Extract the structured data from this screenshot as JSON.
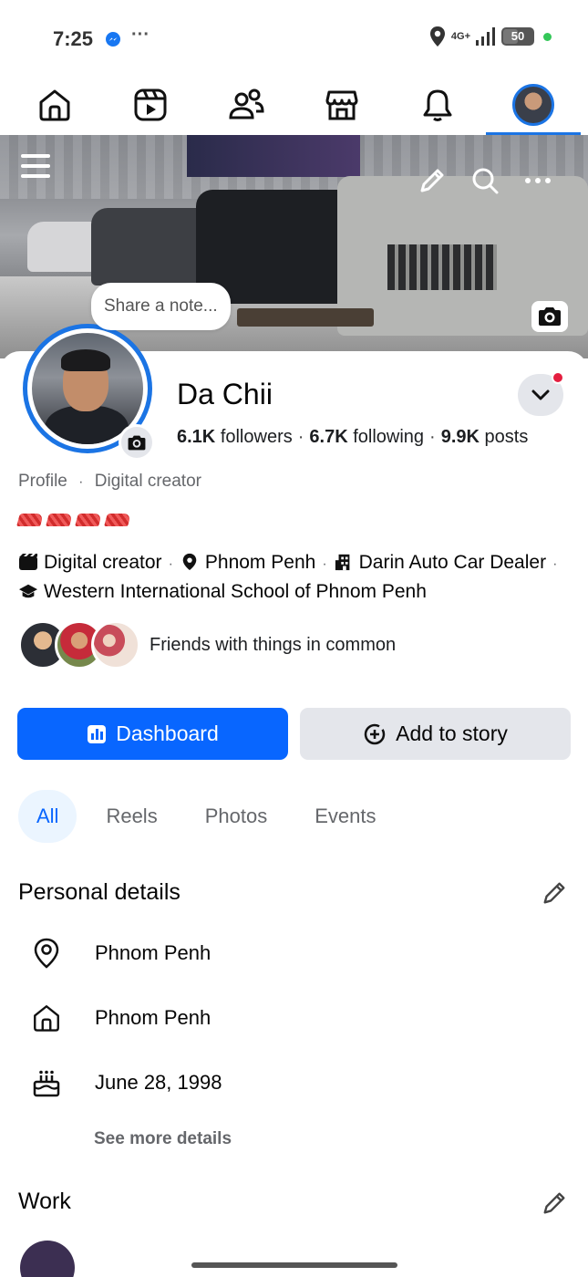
{
  "status_bar": {
    "time": "7:25",
    "more": "···",
    "network": "4G+",
    "battery": "50",
    "battery_level_percent": 50
  },
  "nav": {
    "items": [
      "home-icon",
      "reels-icon",
      "friends-icon",
      "marketplace-icon",
      "notifications-icon",
      "profile-avatar"
    ],
    "active_index": 5
  },
  "cover": {
    "note_prompt": "Share a note..."
  },
  "profile": {
    "name": "Da Chii",
    "followers_count": "6.1K",
    "followers_label": "followers",
    "following_count": "6.7K",
    "following_label": "following",
    "posts_count": "9.9K",
    "posts_label": "posts",
    "type": "Profile",
    "category": "Digital creator"
  },
  "intro": {
    "creator": "Digital creator",
    "location": "Phnom Penh",
    "work": "Darin Auto Car Dealer",
    "school": "Western International School of Phnom Penh"
  },
  "mutuals": {
    "text": "Friends with things in common"
  },
  "actions": {
    "dashboard": "Dashboard",
    "add_story": "Add to story"
  },
  "tabs": [
    "All",
    "Reels",
    "Photos",
    "Events"
  ],
  "personal_details": {
    "title": "Personal details",
    "current_city": "Phnom Penh",
    "hometown": "Phnom Penh",
    "birthday": "June 28, 1998",
    "see_more": "See more details"
  },
  "work_section": {
    "title": "Work"
  },
  "colors": {
    "accent": "#0866ff",
    "nav_active": "#1b74e4",
    "secondary_button": "#e4e6eb",
    "notification_dot": "#e41e3f"
  }
}
